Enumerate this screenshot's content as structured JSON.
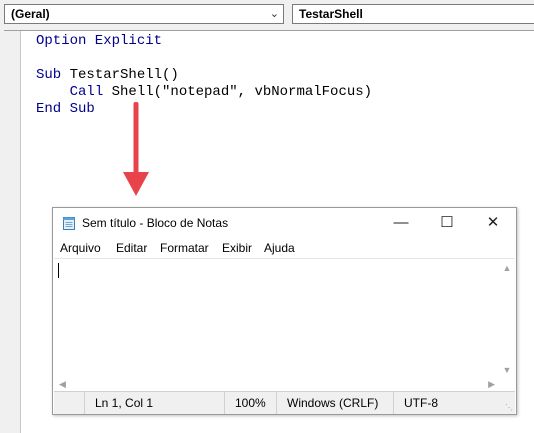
{
  "vba": {
    "object_combo": "(Geral)",
    "procedure_combo": "TestarShell",
    "code": {
      "line1": "Option Explicit",
      "line3_kw": "Sub",
      "line3_rest": " TestarShell()",
      "line4_indent": "    ",
      "line4_kw": "Call",
      "line4_rest": " Shell(\"notepad\", vbNormalFocus)",
      "line5": "End Sub"
    }
  },
  "annotation": {
    "arrow_color": "#e8434a"
  },
  "notepad": {
    "title": "Sem título - Bloco de Notas",
    "controls": {
      "minimize": "—",
      "maximize": "☐",
      "close": "✕"
    },
    "menu": [
      "Arquivo",
      "Editar",
      "Formatar",
      "Exibir",
      "Ajuda"
    ],
    "status": {
      "position": "Ln 1, Col 1",
      "zoom": "100%",
      "line_ending": "Windows (CRLF)",
      "encoding": "UTF-8"
    }
  }
}
